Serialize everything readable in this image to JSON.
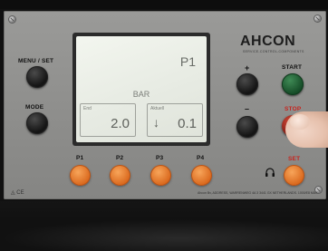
{
  "brand": {
    "name": "AHCON",
    "tagline": "SERVICE-CONTROL-COMPONENTS"
  },
  "left_buttons": {
    "menu_set_label": "MENU / SET",
    "mode_label": "MODE"
  },
  "display": {
    "program": "P1",
    "unit": "BAR",
    "end_box": {
      "title": "End",
      "value": "2.0"
    },
    "actual_box": {
      "title": "Aktuell",
      "value": "0.1",
      "trend_arrow": "↓"
    }
  },
  "right_buttons": {
    "plus_label": "+",
    "start_label": "START",
    "minus_label": "–",
    "stop_label": "STOP",
    "set_label": "SET"
  },
  "program_buttons": [
    "P1",
    "P2",
    "P3",
    "P4"
  ],
  "footer": {
    "ce_mark": "◬ CE",
    "fine_print": "Ahcon Bv, ADDRESS, WARRENWEG 4A 3 3441 GX NETHERLANDS. 1000/E8 MAX"
  },
  "colors": {
    "panel": "#8e8e8c",
    "start_button": "#1e6a37",
    "stop_button": "#b33326",
    "program_button": "#f08a3a",
    "stop_label": "#c8231d"
  }
}
